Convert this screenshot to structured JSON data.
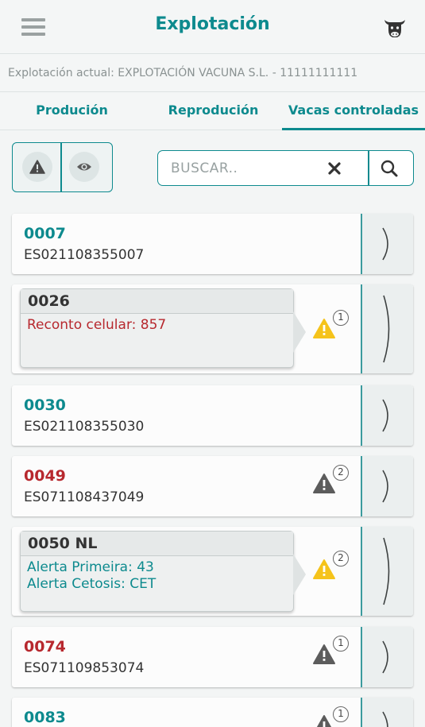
{
  "header": {
    "title": "Explotación",
    "menu_icon": "hamburger-menu-icon",
    "profile_icon": "cow-icon"
  },
  "farm_line": "Explotación actual: EXPLOTACIÓN VACUNA S.L. - 11111111111",
  "tabs": [
    {
      "label": "Produción",
      "active": false
    },
    {
      "label": "Reprodución",
      "active": false
    },
    {
      "label": "Vacas controladas",
      "active": true
    }
  ],
  "filters": {
    "alert_icon": "warning-icon",
    "view_icon": "eye-icon"
  },
  "search": {
    "placeholder": "BUSCAR..",
    "value": "",
    "clear_icon": "close-icon",
    "search_icon": "search-icon"
  },
  "colors": {
    "accent": "#0d8a8e",
    "alert_red": "#b7282e",
    "warning_yellow": "#f5c31b",
    "warning_gray": "#5c5c5c"
  },
  "cows": [
    {
      "code": "0007",
      "id": "ES021108355007",
      "code_color": "teal",
      "alert_count": null,
      "expanded": false
    },
    {
      "code": "0026",
      "code_color": "dark",
      "alert_count": "1",
      "alert_type": "yellow",
      "expanded": true,
      "details": [
        {
          "text": "Reconto celular: 857",
          "color": "red"
        }
      ]
    },
    {
      "code": "0030",
      "id": "ES021108355030",
      "code_color": "teal",
      "alert_count": null,
      "expanded": false
    },
    {
      "code": "0049",
      "id": "ES071108437049",
      "code_color": "red",
      "alert_count": "2",
      "alert_type": "gray",
      "expanded": false
    },
    {
      "code": "0050 NL",
      "code_color": "dark",
      "alert_count": "2",
      "alert_type": "yellow",
      "expanded": true,
      "details": [
        {
          "text": "Alerta Primeira: 43",
          "color": "teal"
        },
        {
          "text": "Alerta Cetosis: CET",
          "color": "teal"
        }
      ]
    },
    {
      "code": "0074",
      "id": "ES071109853074",
      "code_color": "red",
      "alert_count": "1",
      "alert_type": "gray",
      "expanded": false
    },
    {
      "code": "0083",
      "code_color": "teal",
      "alert_count": "1",
      "alert_type": "gray",
      "expanded": false
    }
  ]
}
